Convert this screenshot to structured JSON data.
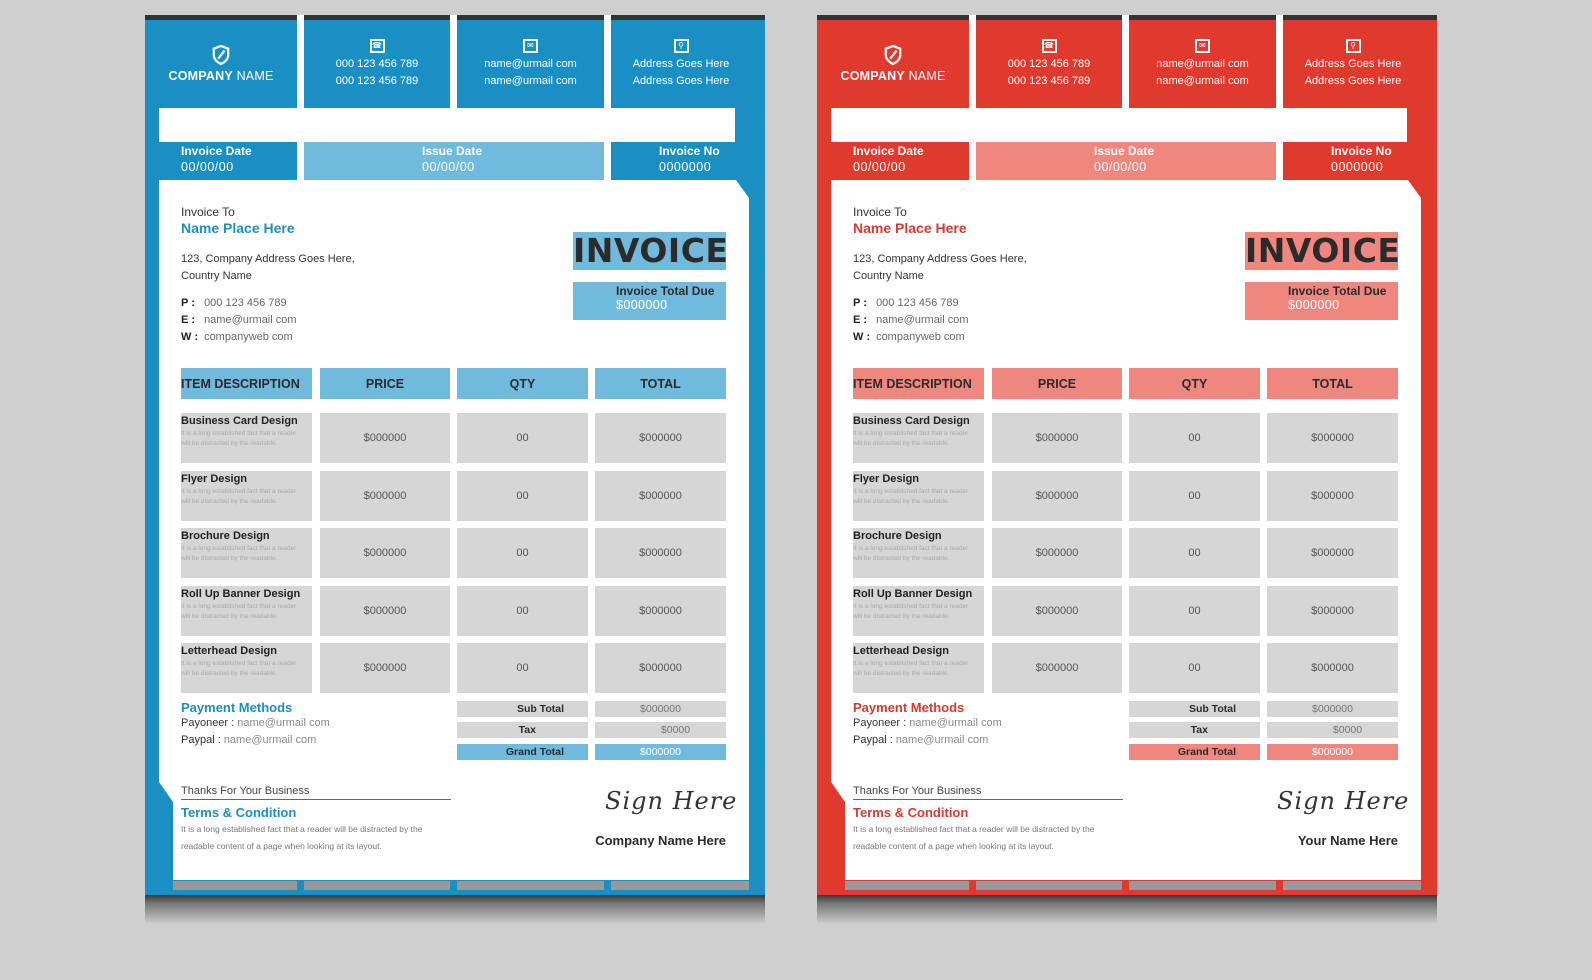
{
  "company": {
    "bold": "COMPANY",
    "rest": "NAME"
  },
  "phones": [
    "000 123 456 789",
    "000 123 456 789"
  ],
  "emails": [
    "name@urmail com",
    "name@urmail com"
  ],
  "addresses": [
    "Address Goes Here",
    "Address Goes Here"
  ],
  "meta": {
    "invoice_date_label": "Invoice Date",
    "invoice_date": "00/00/00",
    "issue_date_label": "Issue Date",
    "issue_date": "00/00/00",
    "invoice_no_label": "Invoice No",
    "invoice_no": "0000000"
  },
  "bill_to": {
    "label": "Invoice To",
    "name": "Name Place Here",
    "address_1": "123, Company Address Goes Here,",
    "address_2": "Country Name",
    "phone_key": "P  :",
    "phone": "000 123 456 789",
    "email_key": "E  :",
    "email": "name@urmail com",
    "web_key": "W :",
    "web": "companyweb com"
  },
  "title": "INVOICE",
  "total_due": {
    "label": "Invoice Total Due",
    "value": "$000000"
  },
  "table": {
    "headers": [
      "ITEM DESCRIPTION",
      "PRICE",
      "QTY",
      "TOTAL"
    ],
    "desc_text_1": "It is a long established fact that a reader",
    "desc_text_2": "will be distracted by the readable.",
    "rows": [
      {
        "item": "Business Card Design",
        "price": "$000000",
        "qty": "00",
        "total": "$000000"
      },
      {
        "item": "Flyer Design",
        "price": "$000000",
        "qty": "00",
        "total": "$000000"
      },
      {
        "item": "Brochure Design",
        "price": "$000000",
        "qty": "00",
        "total": "$000000"
      },
      {
        "item": "Roll Up Banner Design",
        "price": "$000000",
        "qty": "00",
        "total": "$000000"
      },
      {
        "item": "Letterhead Design",
        "price": "$000000",
        "qty": "00",
        "total": "$000000"
      }
    ]
  },
  "summary": {
    "sub_total_label": "Sub Total",
    "sub_total": "$000000",
    "tax_label": "Tax",
    "tax": "$0000",
    "grand_total_label": "Grand Total",
    "grand_total": "$000000"
  },
  "payment": {
    "heading": "Payment Methods",
    "payoneer_key": "Payoneer :",
    "payoneer": "name@urmail com",
    "paypal_key": "Paypal :",
    "paypal": "name@urmail com"
  },
  "thanks": "Thanks For Your Business",
  "terms": {
    "heading": "Terms & Condition",
    "body_1": "It is a long established fact that a reader will be distracted by the",
    "body_2": "readable content of a page when looking at its layout."
  },
  "signature": "Sign Here",
  "signers": {
    "blue": "Company Name Here",
    "red": "Your Name Here"
  },
  "themes": {
    "blue": {
      "main": "#1a8fc4",
      "light": "#6fbadd"
    },
    "red": {
      "main": "#e03a2e",
      "light": "#ef877f"
    }
  }
}
